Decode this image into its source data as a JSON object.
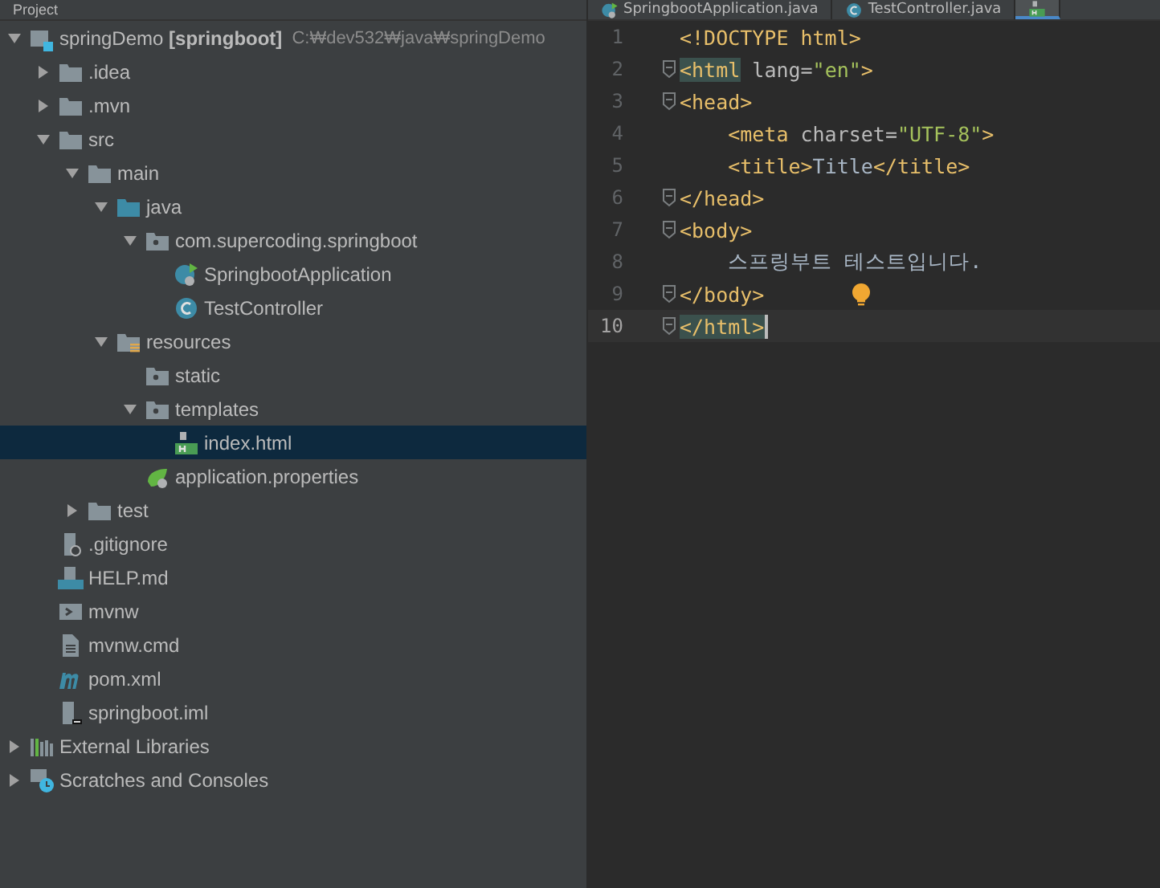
{
  "project_panel": {
    "title": "Project",
    "tree": [
      {
        "label": "springDemo **[springboot]**",
        "path": "C:₩dev532₩java₩springDemo",
        "kind": "module",
        "expanded": true,
        "selected": false,
        "children": [
          {
            "label": ".idea",
            "kind": "folder",
            "expanded": false,
            "selected": false
          },
          {
            "label": ".mvn",
            "kind": "folder",
            "expanded": false,
            "selected": false
          },
          {
            "label": "src",
            "kind": "folder",
            "expanded": true,
            "selected": false,
            "children": [
              {
                "label": "main",
                "kind": "folder",
                "expanded": true,
                "selected": false,
                "children": [
                  {
                    "label": "java",
                    "kind": "source-folder",
                    "expanded": true,
                    "selected": false,
                    "children": [
                      {
                        "label": "com.supercoding.springboot",
                        "kind": "package",
                        "expanded": true,
                        "selected": false,
                        "children": [
                          {
                            "label": "SpringbootApplication",
                            "kind": "spring-class",
                            "selected": false
                          },
                          {
                            "label": "TestController",
                            "kind": "class",
                            "selected": false
                          }
                        ]
                      }
                    ]
                  },
                  {
                    "label": "resources",
                    "kind": "resources-folder",
                    "expanded": true,
                    "selected": false,
                    "children": [
                      {
                        "label": "static",
                        "kind": "package",
                        "selected": false
                      },
                      {
                        "label": "templates",
                        "kind": "package",
                        "expanded": true,
                        "selected": false,
                        "children": [
                          {
                            "label": "index.html",
                            "kind": "html-file",
                            "selected": true
                          }
                        ]
                      },
                      {
                        "label": "application.properties",
                        "kind": "spring-properties",
                        "selected": false
                      }
                    ]
                  }
                ]
              },
              {
                "label": "test",
                "kind": "folder",
                "expanded": false,
                "selected": false
              }
            ]
          },
          {
            "label": ".gitignore",
            "kind": "gitignore",
            "selected": false
          },
          {
            "label": "HELP.md",
            "kind": "markdown",
            "selected": false
          },
          {
            "label": "mvnw",
            "kind": "shell",
            "selected": false
          },
          {
            "label": "mvnw.cmd",
            "kind": "text-file",
            "selected": false
          },
          {
            "label": "pom.xml",
            "kind": "maven",
            "selected": false
          },
          {
            "label": "springboot.iml",
            "kind": "iml",
            "selected": false
          }
        ]
      },
      {
        "label": "External Libraries",
        "kind": "libraries",
        "expanded": false,
        "selected": false
      },
      {
        "label": "Scratches and Consoles",
        "kind": "scratches",
        "expanded": false,
        "selected": false
      }
    ]
  },
  "editor": {
    "tabs": [
      {
        "label": "SpringbootApplication.java",
        "kind": "spring-class",
        "selected": false
      },
      {
        "label": "TestController.java",
        "kind": "class",
        "selected": false
      },
      {
        "kind": "html-file",
        "selected": true
      }
    ],
    "lines": [
      {
        "number": "1",
        "fold": false,
        "current": false,
        "bulb": false,
        "tokens": [
          {
            "text": "<!DOCTYPE html>",
            "kind": "tag"
          }
        ]
      },
      {
        "number": "2",
        "fold": true,
        "current": false,
        "bulb": false,
        "tokens": [
          {
            "text": "<html",
            "kind": "tag",
            "match": true
          },
          {
            "text": " lang=",
            "kind": "attr"
          },
          {
            "text": "\"en\"",
            "kind": "value"
          },
          {
            "text": ">",
            "kind": "tag"
          }
        ]
      },
      {
        "number": "3",
        "fold": true,
        "current": false,
        "bulb": false,
        "tokens": [
          {
            "text": "<head>",
            "kind": "tag"
          }
        ]
      },
      {
        "number": "4",
        "fold": false,
        "current": false,
        "bulb": false,
        "tokens": [
          {
            "text": "    <meta",
            "kind": "tag"
          },
          {
            "text": " charset=",
            "kind": "attr"
          },
          {
            "text": "\"UTF-8\"",
            "kind": "value"
          },
          {
            "text": ">",
            "kind": "tag"
          }
        ]
      },
      {
        "number": "5",
        "fold": false,
        "current": false,
        "bulb": false,
        "tokens": [
          {
            "text": "    <title>",
            "kind": "tag"
          },
          {
            "text": "Title",
            "kind": "text"
          },
          {
            "text": "</title>",
            "kind": "tag"
          }
        ]
      },
      {
        "number": "6",
        "fold": true,
        "current": false,
        "bulb": false,
        "tokens": [
          {
            "text": "</head>",
            "kind": "tag"
          }
        ]
      },
      {
        "number": "7",
        "fold": true,
        "current": false,
        "bulb": false,
        "tokens": [
          {
            "text": "<body>",
            "kind": "tag"
          }
        ]
      },
      {
        "number": "8",
        "fold": false,
        "current": false,
        "bulb": false,
        "tokens": [
          {
            "text": "    스프링부트 테스트입니다.",
            "kind": "text"
          }
        ]
      },
      {
        "number": "9",
        "fold": true,
        "current": false,
        "bulb": true,
        "tokens": [
          {
            "text": "</body>",
            "kind": "tag"
          }
        ]
      },
      {
        "number": "10",
        "fold": true,
        "current": true,
        "bulb": false,
        "tokens": [
          {
            "text": "</html>",
            "kind": "tag",
            "match": true
          }
        ]
      }
    ]
  }
}
